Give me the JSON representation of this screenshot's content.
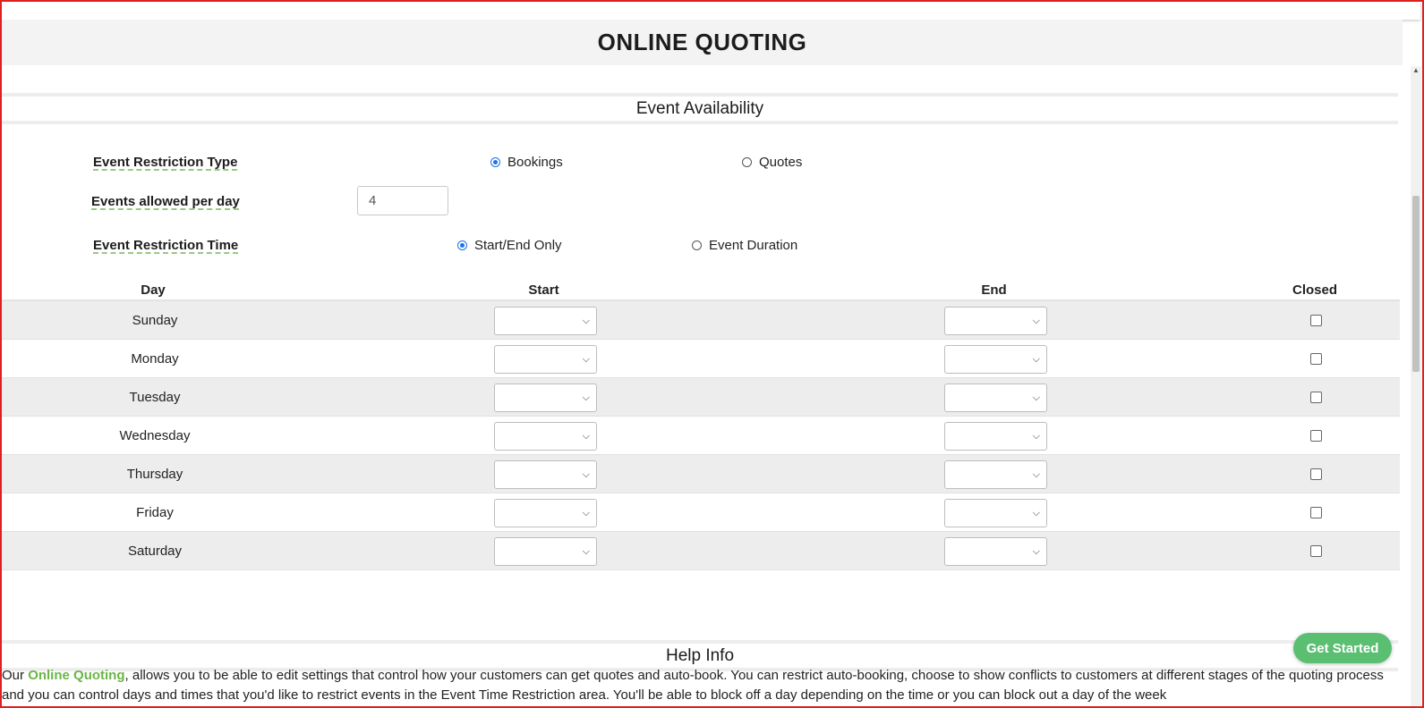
{
  "header": {
    "title": "ONLINE QUOTING"
  },
  "event_availability": {
    "section_title": "Event Availability",
    "restriction_type": {
      "label": "Event Restriction Type",
      "options": [
        "Bookings",
        "Quotes"
      ],
      "selected": "Bookings"
    },
    "events_per_day": {
      "label": "Events allowed per day",
      "value": "4"
    },
    "restriction_time": {
      "label": "Event Restriction Time",
      "options": [
        "Start/End Only",
        "Event Duration"
      ],
      "selected": "Start/End Only"
    },
    "table": {
      "headers": [
        "Day",
        "Start",
        "End",
        "Closed"
      ],
      "rows": [
        {
          "day": "Sunday",
          "start": "",
          "end": "",
          "closed": false
        },
        {
          "day": "Monday",
          "start": "",
          "end": "",
          "closed": false
        },
        {
          "day": "Tuesday",
          "start": "",
          "end": "",
          "closed": false
        },
        {
          "day": "Wednesday",
          "start": "",
          "end": "",
          "closed": false
        },
        {
          "day": "Thursday",
          "start": "",
          "end": "",
          "closed": false
        },
        {
          "day": "Friday",
          "start": "",
          "end": "",
          "closed": false
        },
        {
          "day": "Saturday",
          "start": "",
          "end": "",
          "closed": false
        }
      ]
    }
  },
  "help": {
    "section_title": "Help Info",
    "intro": "Our ",
    "link_text": "Online Quoting",
    "body": ", allows you to be able to edit settings that control how your customers can get quotes and auto-book. You can restrict auto-booking, choose to show conflicts to customers at different stages of the quoting process and you can control days and times that you'd like to restrict events in the Event Time Restriction area. You'll be able to block off a day depending on the time or you can block out a day of the week"
  },
  "get_started": {
    "label": "Get Started"
  },
  "colors": {
    "accent": "#6bb547",
    "radio": "#1a73e8",
    "button": "#5bbf72"
  }
}
